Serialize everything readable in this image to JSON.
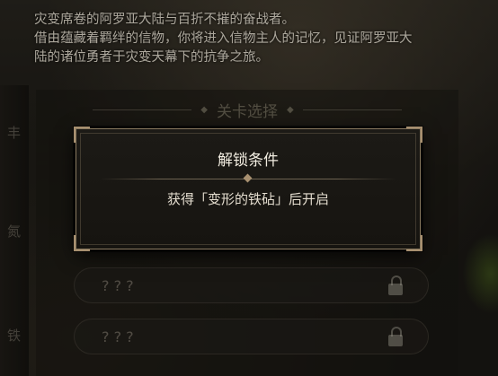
{
  "description": {
    "line1": "灾变席卷的阿罗亚大陆与百折不摧的奋战者。",
    "line2": "借由蕴藏着羁绊的信物，你将进入信物主人的记忆，见证阿罗亚大",
    "line3": "陆的诸位勇者于灾变天幕下的抗争之旅。"
  },
  "stage_select": {
    "title": "关卡选择",
    "locked_items": [
      {
        "label": "? ? ?"
      },
      {
        "label": "? ? ?"
      }
    ]
  },
  "left_tabs": [
    "丰",
    "氮",
    "铁"
  ],
  "modal": {
    "title": "解锁条件",
    "message": "获得「变形的铁砧」后开启"
  },
  "icons": {
    "lock": "lock-icon",
    "divider": "diamond-ornament-icon"
  }
}
